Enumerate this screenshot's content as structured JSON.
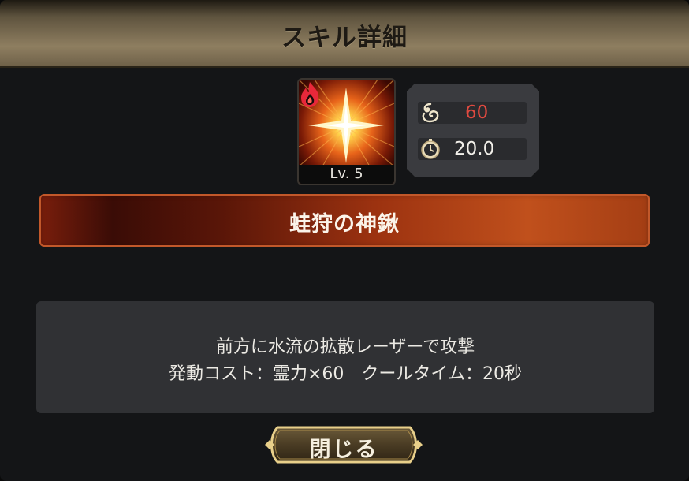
{
  "header": {
    "title": "スキル詳細"
  },
  "skill": {
    "icon": "fire-burst-icon",
    "element_badge": "fire-element-icon",
    "level": "Lv. 5",
    "name": "蛙狩の神鍬"
  },
  "stats": {
    "cost": {
      "icon": "spirit-power-icon",
      "value": "60",
      "color": "#e04a40"
    },
    "cooldown": {
      "icon": "stopwatch-icon",
      "value": "20.0",
      "color": "#f2f0ea"
    }
  },
  "description": {
    "line1": "前方に水流の拡散レーザーで攻撃",
    "line2": "発動コスト：霊力×60　クールタイム：20秒"
  },
  "close_button": {
    "label": "閉じる"
  },
  "colors": {
    "header_gold": "#8e7e60",
    "banner_red": "#9c3210",
    "panel_bg": "#303134",
    "dialog_bg": "#141517"
  }
}
